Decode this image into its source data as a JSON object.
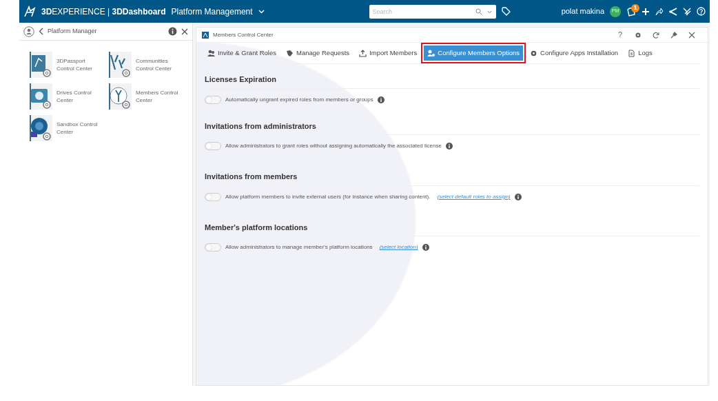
{
  "topbar": {
    "brand": "**3D**EXPERIENCE | **3DDashboard**",
    "dashboard": "Platform Management",
    "search": {
      "placeholder": "Search"
    },
    "user": "polat makina",
    "avatar": "PM",
    "notification_badge": "1"
  },
  "sidebar": {
    "title": "Platform Manager",
    "apps": [
      {
        "label": "3DPassport Control Center"
      },
      {
        "label": "Communities Control Center"
      },
      {
        "label": "Drives Control Center"
      },
      {
        "label": "Members Control Center"
      },
      {
        "label": "Sandbox Control Center"
      }
    ]
  },
  "widget": {
    "title": "Members Control Center",
    "help": "?",
    "tabs": [
      {
        "label": "Invite & Grant Roles",
        "selected": false
      },
      {
        "label": "Manage Requests",
        "selected": false
      },
      {
        "label": "Import Members",
        "selected": false
      },
      {
        "label": "Configure Members Options",
        "selected": true
      },
      {
        "label": "Configure Apps Installation",
        "selected": false
      },
      {
        "label": "Logs",
        "selected": false
      }
    ],
    "sections": [
      {
        "heading": "Licenses Expiration",
        "options": [
          {
            "text": "Automatically ungrant expired roles from members or groups",
            "on": false
          }
        ]
      },
      {
        "heading": "Invitations from administrators",
        "options": [
          {
            "text": "Allow administrators to grant roles without assigning automatically the associated license",
            "on": false
          }
        ]
      },
      {
        "heading": "Invitations from members",
        "options": [
          {
            "text": "Allow platform members to invite external users (for instance when sharing content).",
            "link": "(select default roles to assign)",
            "on": false
          }
        ]
      },
      {
        "heading": "Member's platform locations",
        "options": [
          {
            "text": "Allow administrators to manage member's platform locations",
            "link": "(select location)",
            "on": false
          }
        ]
      }
    ]
  }
}
